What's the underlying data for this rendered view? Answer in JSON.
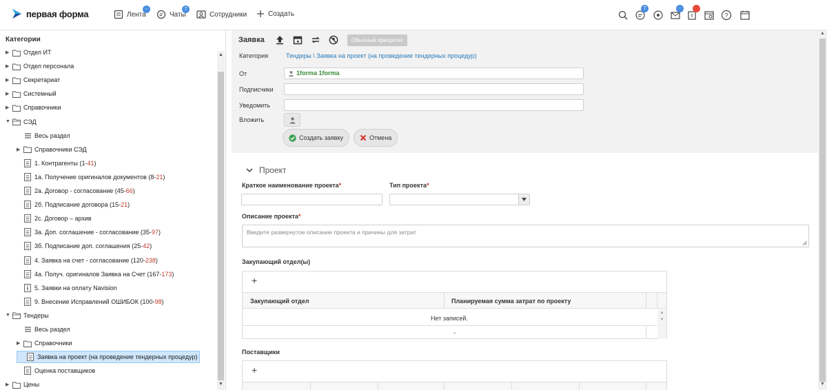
{
  "app": {
    "logo_text": "первая форма"
  },
  "nav": [
    {
      "label": "Лента",
      "badge": "-"
    },
    {
      "label": "Чаты",
      "badge": "7"
    },
    {
      "label": "Сотрудники"
    },
    {
      "label": "Создать"
    }
  ],
  "top_icons": [
    {
      "name": "search-icon"
    },
    {
      "name": "chat-bubble-icon",
      "badge": "7"
    },
    {
      "name": "record-icon"
    },
    {
      "name": "mail-icon",
      "badge": "-"
    },
    {
      "name": "tasks-icon",
      "badge": "1"
    },
    {
      "name": "calendar-settings-icon"
    },
    {
      "name": "help-icon"
    },
    {
      "name": "calendar-icon"
    }
  ],
  "sidebar": {
    "title": "Категории",
    "items": [
      {
        "label": "Отдел ИТ"
      },
      {
        "label": "Отдел персонала"
      },
      {
        "label": "Секретариат"
      },
      {
        "label": "Системный"
      },
      {
        "label": "Справочники"
      },
      {
        "label": "СЭД"
      },
      {
        "label": "Весь раздел"
      },
      {
        "label": "Справочники СЭД"
      },
      {
        "label": "1. Контрагенты (1-",
        "count": "41",
        "close": ")"
      },
      {
        "label": "1а. Получение оригиналов документов (8-",
        "count": "21",
        "close": ")"
      },
      {
        "label": "2а. Договор - согласование (45-",
        "count": "66",
        "close": ")"
      },
      {
        "label": "2б. Подписание договора (15-",
        "count": "21",
        "close": ")"
      },
      {
        "label": "2с. Договор – архив"
      },
      {
        "label": "3а. Доп. соглашение - согласование (35-",
        "count": "97",
        "close": ")"
      },
      {
        "label": "3б. Подписание доп. соглашения (25-",
        "count": "42",
        "close": ")"
      },
      {
        "label": "4. Заявка на счет - согласование (120-",
        "count": "238",
        "close": ")"
      },
      {
        "label": "4а. Получ. оригиналов Заявка на Счет (167-",
        "count": "173",
        "close": ")"
      },
      {
        "label": "5. Заявки на оплату Navision"
      },
      {
        "label": "9. Внесение Исправлений ОШИБОК (100-",
        "count": "98",
        "close": ")"
      },
      {
        "label": "Тендеры"
      },
      {
        "label": "Весь раздел"
      },
      {
        "label": "Справочники"
      },
      {
        "label": "Заявка на проект (на проведение тендерных процедур)"
      },
      {
        "label": "Оценка поставщиков"
      },
      {
        "label": "Цены"
      }
    ]
  },
  "form": {
    "title": "Заявка",
    "priority_label": "Обычный приоритет",
    "category_label": "Категория",
    "category_value": "Тендеры \\ Заявка на проект (на проведение тендерных процедур)",
    "from_label": "От",
    "from_value": "1forma 1forma",
    "subscribers_label": "Подписчики",
    "notify_label": "Уведомить",
    "attach_label": "Вложить",
    "create_label": "Создать заявку",
    "cancel_label": "Отмена"
  },
  "project": {
    "section_title": "Проект",
    "short_name_label": "Краткое наименование проекта",
    "type_label": "Тип проекта",
    "req_mark": "*",
    "description_label": "Описание проекта",
    "description_placeholder": "Введите развернутое описание проекта и причины для затрат",
    "purchasing_label": "Закупающий отдел(ы)",
    "purchasing_columns": [
      "Закупающий отдел",
      "Планируемая сумма затрат по проекту"
    ],
    "no_records": "Нет записей.",
    "dash": "-",
    "suppliers_label": "Поставщики"
  },
  "colors": {
    "accent": "#2a7ab8",
    "badge": "#4a8ee0",
    "required": "#c0392b",
    "user": "#3a8c3a"
  }
}
